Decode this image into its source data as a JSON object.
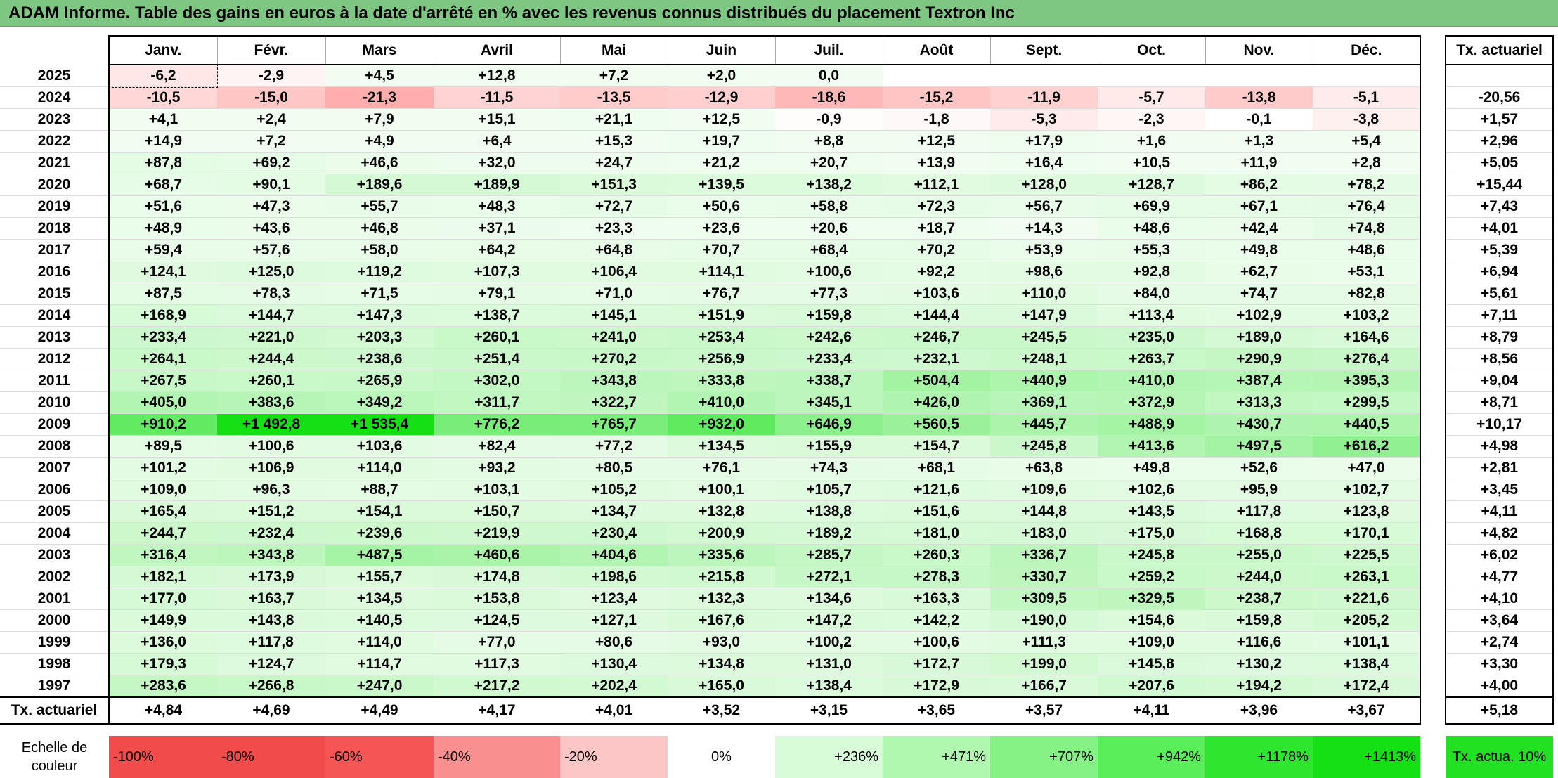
{
  "title": "ADAM Informe. Table des gains en euros à la date d'arrêté en % avec les revenus connus distribués du placement Textron Inc",
  "months": [
    "Janv.",
    "Févr.",
    "Mars",
    "Avril",
    "Mai",
    "Juin",
    "Juil.",
    "Août",
    "Sept.",
    "Oct.",
    "Nov.",
    "Déc."
  ],
  "rate_header": "Tx. actuariel",
  "rows": [
    {
      "year": "2025",
      "values": [
        "-6,2",
        "-2,9",
        "+4,5",
        "+12,8",
        "+7,2",
        "+2,0",
        "0,0",
        "",
        "",
        "",
        "",
        ""
      ],
      "rate": ""
    },
    {
      "year": "2024",
      "values": [
        "-10,5",
        "-15,0",
        "-21,3",
        "-11,5",
        "-13,5",
        "-12,9",
        "-18,6",
        "-15,2",
        "-11,9",
        "-5,7",
        "-13,8",
        "-5,1"
      ],
      "rate": "-20,56"
    },
    {
      "year": "2023",
      "values": [
        "+4,1",
        "+2,4",
        "+7,9",
        "+15,1",
        "+21,1",
        "+12,5",
        "-0,9",
        "-1,8",
        "-5,3",
        "-2,3",
        "-0,1",
        "-3,8"
      ],
      "rate": "+1,57"
    },
    {
      "year": "2022",
      "values": [
        "+14,9",
        "+7,2",
        "+4,9",
        "+6,4",
        "+15,3",
        "+19,7",
        "+8,8",
        "+12,5",
        "+17,9",
        "+1,6",
        "+1,3",
        "+5,4"
      ],
      "rate": "+2,96"
    },
    {
      "year": "2021",
      "values": [
        "+87,8",
        "+69,2",
        "+46,6",
        "+32,0",
        "+24,7",
        "+21,2",
        "+20,7",
        "+13,9",
        "+16,4",
        "+10,5",
        "+11,9",
        "+2,8"
      ],
      "rate": "+5,05"
    },
    {
      "year": "2020",
      "values": [
        "+68,7",
        "+90,1",
        "+189,6",
        "+189,9",
        "+151,3",
        "+139,5",
        "+138,2",
        "+112,1",
        "+128,0",
        "+128,7",
        "+86,2",
        "+78,2"
      ],
      "rate": "+15,44"
    },
    {
      "year": "2019",
      "values": [
        "+51,6",
        "+47,3",
        "+55,7",
        "+48,3",
        "+72,7",
        "+50,6",
        "+58,8",
        "+72,3",
        "+56,7",
        "+69,9",
        "+67,1",
        "+76,4"
      ],
      "rate": "+7,43"
    },
    {
      "year": "2018",
      "values": [
        "+48,9",
        "+43,6",
        "+46,8",
        "+37,1",
        "+23,3",
        "+23,6",
        "+20,6",
        "+18,7",
        "+14,3",
        "+48,6",
        "+42,4",
        "+74,8"
      ],
      "rate": "+4,01"
    },
    {
      "year": "2017",
      "values": [
        "+59,4",
        "+57,6",
        "+58,0",
        "+64,2",
        "+64,8",
        "+70,7",
        "+68,4",
        "+70,2",
        "+53,9",
        "+55,3",
        "+49,8",
        "+48,6"
      ],
      "rate": "+5,39"
    },
    {
      "year": "2016",
      "values": [
        "+124,1",
        "+125,0",
        "+119,2",
        "+107,3",
        "+106,4",
        "+114,1",
        "+100,6",
        "+92,2",
        "+98,6",
        "+92,8",
        "+62,7",
        "+53,1"
      ],
      "rate": "+6,94"
    },
    {
      "year": "2015",
      "values": [
        "+87,5",
        "+78,3",
        "+71,5",
        "+79,1",
        "+71,0",
        "+76,7",
        "+77,3",
        "+103,6",
        "+110,0",
        "+84,0",
        "+74,7",
        "+82,8"
      ],
      "rate": "+5,61"
    },
    {
      "year": "2014",
      "values": [
        "+168,9",
        "+144,7",
        "+147,3",
        "+138,7",
        "+145,1",
        "+151,9",
        "+159,8",
        "+144,4",
        "+147,9",
        "+113,4",
        "+102,9",
        "+103,2"
      ],
      "rate": "+7,11"
    },
    {
      "year": "2013",
      "values": [
        "+233,4",
        "+221,0",
        "+203,3",
        "+260,1",
        "+241,0",
        "+253,4",
        "+242,6",
        "+246,7",
        "+245,5",
        "+235,0",
        "+189,0",
        "+164,6"
      ],
      "rate": "+8,79"
    },
    {
      "year": "2012",
      "values": [
        "+264,1",
        "+244,4",
        "+238,6",
        "+251,4",
        "+270,2",
        "+256,9",
        "+233,4",
        "+232,1",
        "+248,1",
        "+263,7",
        "+290,9",
        "+276,4"
      ],
      "rate": "+8,56"
    },
    {
      "year": "2011",
      "values": [
        "+267,5",
        "+260,1",
        "+265,9",
        "+302,0",
        "+343,8",
        "+333,8",
        "+338,7",
        "+504,4",
        "+440,9",
        "+410,0",
        "+387,4",
        "+395,3"
      ],
      "rate": "+9,04"
    },
    {
      "year": "2010",
      "values": [
        "+405,0",
        "+383,6",
        "+349,2",
        "+311,7",
        "+322,7",
        "+410,0",
        "+345,1",
        "+426,0",
        "+369,1",
        "+372,9",
        "+313,3",
        "+299,5"
      ],
      "rate": "+8,71"
    },
    {
      "year": "2009",
      "values": [
        "+910,2",
        "+1 492,8",
        "+1 535,4",
        "+776,2",
        "+765,7",
        "+932,0",
        "+646,9",
        "+560,5",
        "+445,7",
        "+488,9",
        "+430,7",
        "+440,5"
      ],
      "rate": "+10,17"
    },
    {
      "year": "2008",
      "values": [
        "+89,5",
        "+100,6",
        "+103,6",
        "+82,4",
        "+77,2",
        "+134,5",
        "+155,9",
        "+154,7",
        "+245,8",
        "+413,6",
        "+497,5",
        "+616,2"
      ],
      "rate": "+4,98"
    },
    {
      "year": "2007",
      "values": [
        "+101,2",
        "+106,9",
        "+114,0",
        "+93,2",
        "+80,5",
        "+76,1",
        "+74,3",
        "+68,1",
        "+63,8",
        "+49,8",
        "+52,6",
        "+47,0"
      ],
      "rate": "+2,81"
    },
    {
      "year": "2006",
      "values": [
        "+109,0",
        "+96,3",
        "+88,7",
        "+103,1",
        "+105,2",
        "+100,1",
        "+105,7",
        "+121,6",
        "+109,6",
        "+102,6",
        "+95,9",
        "+102,7"
      ],
      "rate": "+3,45"
    },
    {
      "year": "2005",
      "values": [
        "+165,4",
        "+151,2",
        "+154,1",
        "+150,7",
        "+134,7",
        "+132,8",
        "+138,8",
        "+151,6",
        "+144,8",
        "+143,5",
        "+117,8",
        "+123,8"
      ],
      "rate": "+4,11"
    },
    {
      "year": "2004",
      "values": [
        "+244,7",
        "+232,4",
        "+239,6",
        "+219,9",
        "+230,4",
        "+200,9",
        "+189,2",
        "+181,0",
        "+183,0",
        "+175,0",
        "+168,8",
        "+170,1"
      ],
      "rate": "+4,82"
    },
    {
      "year": "2003",
      "values": [
        "+316,4",
        "+343,8",
        "+487,5",
        "+460,6",
        "+404,6",
        "+335,6",
        "+285,7",
        "+260,3",
        "+336,7",
        "+245,8",
        "+255,0",
        "+225,5"
      ],
      "rate": "+6,02"
    },
    {
      "year": "2002",
      "values": [
        "+182,1",
        "+173,9",
        "+155,7",
        "+174,8",
        "+198,6",
        "+215,8",
        "+272,1",
        "+278,3",
        "+330,7",
        "+259,2",
        "+244,0",
        "+263,1"
      ],
      "rate": "+4,77"
    },
    {
      "year": "2001",
      "values": [
        "+177,0",
        "+163,7",
        "+134,5",
        "+153,8",
        "+123,4",
        "+132,3",
        "+134,6",
        "+163,3",
        "+309,5",
        "+329,5",
        "+238,7",
        "+221,6"
      ],
      "rate": "+4,10"
    },
    {
      "year": "2000",
      "values": [
        "+149,9",
        "+143,8",
        "+140,5",
        "+124,5",
        "+127,1",
        "+167,6",
        "+147,2",
        "+142,2",
        "+190,0",
        "+154,6",
        "+159,8",
        "+205,2"
      ],
      "rate": "+3,64"
    },
    {
      "year": "1999",
      "values": [
        "+136,0",
        "+117,8",
        "+114,0",
        "+77,0",
        "+80,6",
        "+93,0",
        "+100,2",
        "+100,6",
        "+111,3",
        "+109,0",
        "+116,6",
        "+101,1"
      ],
      "rate": "+2,74"
    },
    {
      "year": "1998",
      "values": [
        "+179,3",
        "+124,7",
        "+114,7",
        "+117,3",
        "+130,4",
        "+134,8",
        "+131,0",
        "+172,7",
        "+199,0",
        "+145,8",
        "+130,2",
        "+138,4"
      ],
      "rate": "+3,30"
    },
    {
      "year": "1997",
      "values": [
        "+283,6",
        "+266,8",
        "+247,0",
        "+217,2",
        "+202,4",
        "+165,0",
        "+138,4",
        "+172,9",
        "+166,7",
        "+207,6",
        "+194,2",
        "+172,4"
      ],
      "rate": "+4,00"
    }
  ],
  "footer": {
    "label": "Tx. actuariel",
    "values": [
      "+4,84",
      "+4,69",
      "+4,49",
      "+4,17",
      "+4,01",
      "+3,52",
      "+3,15",
      "+3,65",
      "+3,57",
      "+4,11",
      "+3,96",
      "+3,67"
    ],
    "total": "+5,18"
  },
  "scale": {
    "label": "Echelle de couleur",
    "items": [
      {
        "text": "-100%",
        "color": "#f24b4b",
        "align": "left"
      },
      {
        "text": "-80%",
        "color": "#f24b4b",
        "align": "left"
      },
      {
        "text": "-60%",
        "color": "#f65555",
        "align": "left"
      },
      {
        "text": "-40%",
        "color": "#fa8f8f",
        "align": "left"
      },
      {
        "text": "-20%",
        "color": "#fcc6c6",
        "align": "left"
      },
      {
        "text": "0%",
        "color": "#ffffff",
        "align": "center"
      },
      {
        "text": "+236%",
        "color": "#d8fbd8",
        "align": "right"
      },
      {
        "text": "+471%",
        "color": "#b0f7b0",
        "align": "right"
      },
      {
        "text": "+707%",
        "color": "#86f286",
        "align": "right"
      },
      {
        "text": "+942%",
        "color": "#5aee5a",
        "align": "right"
      },
      {
        "text": "+1178%",
        "color": "#2de62d",
        "align": "right"
      },
      {
        "text": "+1413%",
        "color": "#14e014",
        "align": "right"
      }
    ],
    "rate_label": "Tx. actua. 10%",
    "rate_color": "#22e022"
  },
  "colors": {
    "title_bg": "#7dc782",
    "neg_strong": "#f24b4b",
    "pos_strong": "#14e014"
  }
}
